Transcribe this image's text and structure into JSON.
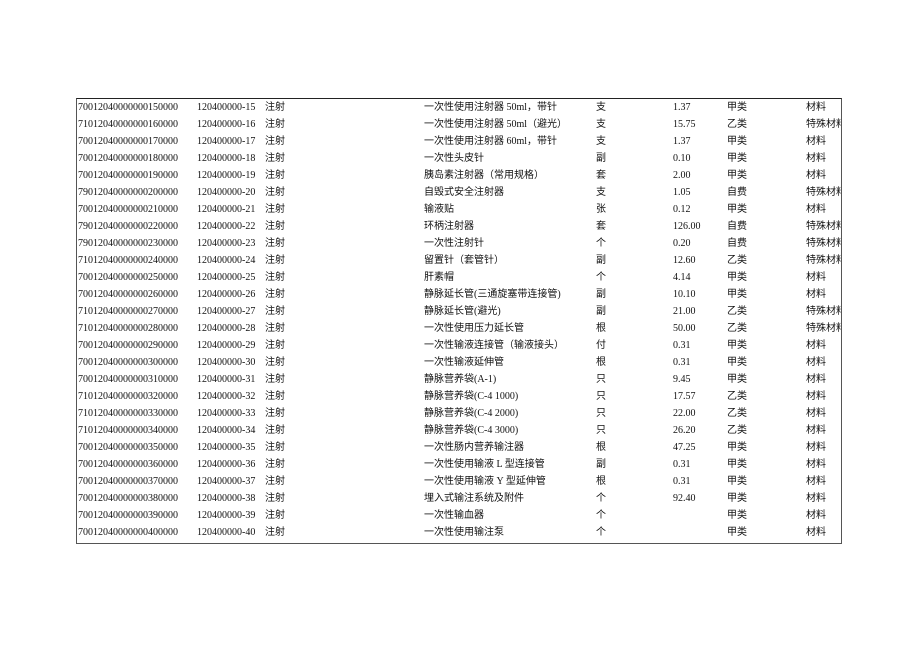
{
  "table": {
    "rows": [
      [
        "70012040000000150000",
        "120400000-15",
        "注射",
        "一次性使用注射器 50ml，带针",
        "支",
        "1.37",
        "甲类",
        "材料"
      ],
      [
        "71012040000000160000",
        "120400000-16",
        "注射",
        "一次性使用注射器 50ml（避光）",
        "支",
        "15.75",
        "乙类",
        "特殊材料"
      ],
      [
        "70012040000000170000",
        "120400000-17",
        "注射",
        "一次性使用注射器 60ml，带针",
        "支",
        "1.37",
        "甲类",
        "材料"
      ],
      [
        "70012040000000180000",
        "120400000-18",
        "注射",
        "一次性头皮针",
        "副",
        "0.10",
        "甲类",
        "材料"
      ],
      [
        "70012040000000190000",
        "120400000-19",
        "注射",
        "胰岛素注射器（常用规格）",
        "套",
        "2.00",
        "甲类",
        "材料"
      ],
      [
        "79012040000000200000",
        "120400000-20",
        "注射",
        "自毁式安全注射器",
        "支",
        "1.05",
        "自费",
        "特殊材料"
      ],
      [
        "70012040000000210000",
        "120400000-21",
        "注射",
        "输液贴",
        "张",
        "0.12",
        "甲类",
        "材料"
      ],
      [
        "79012040000000220000",
        "120400000-22",
        "注射",
        "环柄注射器",
        "套",
        "126.00",
        "自费",
        "特殊材料"
      ],
      [
        "79012040000000230000",
        "120400000-23",
        "注射",
        "一次性注射针",
        "个",
        "0.20",
        "自费",
        "特殊材料"
      ],
      [
        "71012040000000240000",
        "120400000-24",
        "注射",
        "留置针（套管针）",
        "副",
        "12.60",
        "乙类",
        "特殊材料"
      ],
      [
        "70012040000000250000",
        "120400000-25",
        "注射",
        "肝素帽",
        "个",
        "4.14",
        "甲类",
        "材料"
      ],
      [
        "70012040000000260000",
        "120400000-26",
        "注射",
        "静脉延长管(三通旋塞带连接管)",
        "副",
        "10.10",
        "甲类",
        "材料"
      ],
      [
        "71012040000000270000",
        "120400000-27",
        "注射",
        "静脉延长管(避光)",
        "副",
        "21.00",
        "乙类",
        "特殊材料"
      ],
      [
        "71012040000000280000",
        "120400000-28",
        "注射",
        "一次性使用压力延长管",
        "根",
        "50.00",
        "乙类",
        "特殊材料"
      ],
      [
        "70012040000000290000",
        "120400000-29",
        "注射",
        "一次性输液连接管（输液接头）",
        "付",
        "0.31",
        "甲类",
        "材料"
      ],
      [
        "70012040000000300000",
        "120400000-30",
        "注射",
        "一次性输液延伸管",
        "根",
        "0.31",
        "甲类",
        "材料"
      ],
      [
        "70012040000000310000",
        "120400000-31",
        "注射",
        "静脉营养袋(A-1)",
        "只",
        "9.45",
        "甲类",
        "材料"
      ],
      [
        "71012040000000320000",
        "120400000-32",
        "注射",
        "静脉营养袋(C-4 1000)",
        "只",
        "17.57",
        "乙类",
        "材料"
      ],
      [
        "71012040000000330000",
        "120400000-33",
        "注射",
        "静脉营养袋(C-4 2000)",
        "只",
        "22.00",
        "乙类",
        "材料"
      ],
      [
        "71012040000000340000",
        "120400000-34",
        "注射",
        "静脉营养袋(C-4 3000)",
        "只",
        "26.20",
        "乙类",
        "材料"
      ],
      [
        "70012040000000350000",
        "120400000-35",
        "注射",
        "一次性肠内营养输注器",
        "根",
        "47.25",
        "甲类",
        "材料"
      ],
      [
        "70012040000000360000",
        "120400000-36",
        "注射",
        "一次性使用输液 L 型连接管",
        "副",
        "0.31",
        "甲类",
        "材料"
      ],
      [
        "70012040000000370000",
        "120400000-37",
        "注射",
        "一次性使用输液 Y 型延伸管",
        "根",
        "0.31",
        "甲类",
        "材料"
      ],
      [
        "70012040000000380000",
        "120400000-38",
        "注射",
        "埋入式输注系统及附件",
        "个",
        "92.40",
        "甲类",
        "材料"
      ],
      [
        "70012040000000390000",
        "120400000-39",
        "注射",
        "一次性输血器",
        "个",
        "",
        "甲类",
        "材料"
      ],
      [
        "70012040000000400000",
        "120400000-40",
        "注射",
        "一次性使用输注泵",
        "个",
        "",
        "甲类",
        "材料"
      ]
    ]
  }
}
